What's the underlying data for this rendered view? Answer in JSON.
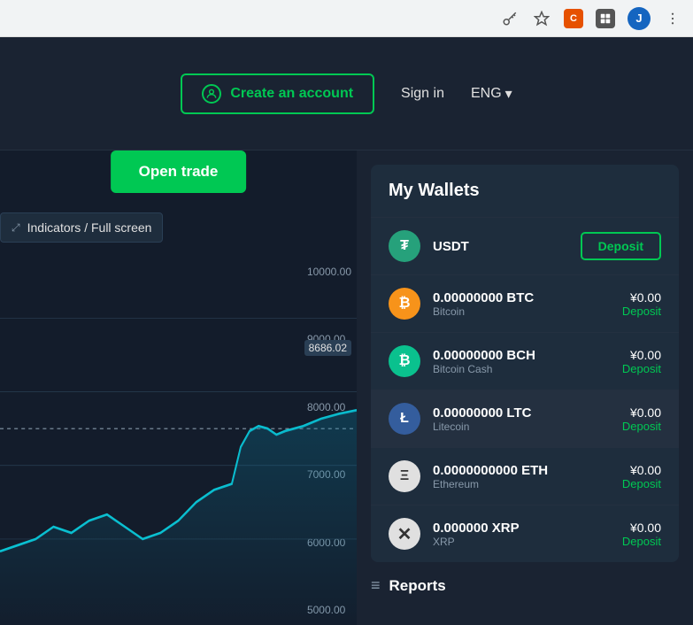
{
  "browser": {
    "icons": [
      "key",
      "star",
      "ext1",
      "ext2",
      "avatar"
    ],
    "avatar_letter": "J"
  },
  "header": {
    "create_account_label": "Create an account",
    "sign_in_label": "Sign in",
    "lang_label": "ENG"
  },
  "chart": {
    "open_trade_label": "Open trade",
    "indicators_label": "Indicators / Full screen",
    "price_levels": [
      "10000.00",
      "9000.00",
      "8000.00",
      "7000.00",
      "6000.00",
      "5000.00"
    ],
    "current_price": "8686.02"
  },
  "wallets": {
    "title": "My Wallets",
    "items": [
      {
        "symbol": "USDT",
        "name": "",
        "icon_type": "usdt",
        "icon_symbol": "₮",
        "balance": "",
        "action": "Deposit",
        "action_type": "button",
        "highlighted": false
      },
      {
        "symbol": "0.00000000 BTC",
        "name": "Bitcoin",
        "icon_type": "btc",
        "icon_symbol": "₿",
        "balance": "¥0.00",
        "action": "Deposit",
        "action_type": "link",
        "highlighted": false
      },
      {
        "symbol": "0.00000000 BCH",
        "name": "Bitcoin Cash",
        "icon_type": "bch",
        "icon_symbol": "₿",
        "balance": "¥0.00",
        "action": "Deposit",
        "action_type": "link",
        "highlighted": false
      },
      {
        "symbol": "0.00000000 LTC",
        "name": "Litecoin",
        "icon_type": "ltc",
        "icon_symbol": "Ł",
        "balance": "¥0.00",
        "action": "Deposit",
        "action_type": "link",
        "highlighted": true
      },
      {
        "symbol": "0.0000000000 ETH",
        "name": "Ethereum",
        "icon_type": "eth",
        "icon_symbol": "Ξ",
        "balance": "¥0.00",
        "action": "Deposit",
        "action_type": "link",
        "highlighted": false
      },
      {
        "symbol": "0.000000 XRP",
        "name": "XRP",
        "icon_type": "xrp",
        "icon_symbol": "✕",
        "balance": "¥0.00",
        "action": "Deposit",
        "action_type": "link",
        "highlighted": false
      }
    ]
  },
  "reports": {
    "label": "Reports"
  }
}
